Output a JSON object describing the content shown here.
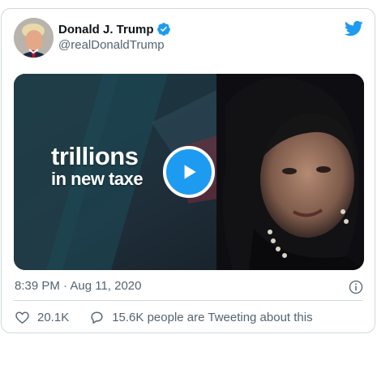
{
  "author": {
    "display_name": "Donald J. Trump",
    "handle": "@realDonaldTrump",
    "verified": true
  },
  "media": {
    "headline_line1": "trillions",
    "headline_line2": "in new taxe",
    "type": "video"
  },
  "meta": {
    "timestamp": "8:39 PM · Aug 11, 2020"
  },
  "actions": {
    "likes": "20.1K",
    "retweets_text": "15.6K people are Tweeting about this"
  },
  "colors": {
    "accent": "#1d9bf0",
    "text_primary": "#0f1419",
    "text_secondary": "#536471",
    "border": "#cfd9de"
  },
  "icons": [
    "avatar",
    "verified-badge-icon",
    "twitter-bird-icon",
    "play-icon",
    "info-icon",
    "heart-icon",
    "speech-bubble-icon"
  ]
}
